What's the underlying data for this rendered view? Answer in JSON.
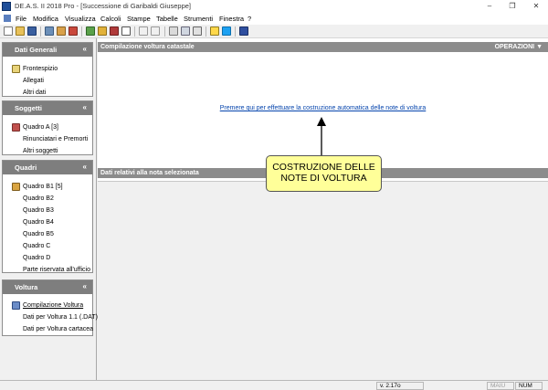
{
  "window": {
    "title": "DE.A.S. II 2018 Pro - [Successione di Garibaldi Giuseppe]",
    "controls": [
      "–",
      "❐",
      "✕"
    ]
  },
  "menubar": {
    "items": [
      "File",
      "Modifica",
      "Visualizza",
      "Calcoli",
      "Stampe",
      "Tabelle",
      "Strumenti",
      "Finestra",
      "?"
    ]
  },
  "sidebar": {
    "panels": [
      {
        "title": "Dati Generali",
        "items": [
          "Frontespizio",
          "Allegati",
          "Altri dati"
        ]
      },
      {
        "title": "Soggetti",
        "items": [
          "Quadro A [3]",
          "Rinunciatari e Premorti",
          "Altri soggetti"
        ]
      },
      {
        "title": "Quadri",
        "items": [
          "Quadro B1 [5]",
          "Quadro B2",
          "Quadro B3",
          "Quadro B4",
          "Quadro B5",
          "Quadro C",
          "Quadro D",
          "Parte riservata all'ufficio"
        ]
      },
      {
        "title": "Voltura",
        "items": [
          "Compilazione Voltura",
          "Dati per Voltura 1.1 (.DAT)",
          "Dati per Voltura cartacea"
        ]
      }
    ]
  },
  "main": {
    "section1_title": "Compilazione voltura catastale",
    "operations_label": "OPERAZIONI ▼",
    "link_text": "Premere qui per effettuare la costruzione automatica delle note di voltura",
    "section2_title": "Dati relativi alla nota selezionata"
  },
  "callout": {
    "line1": "COSTRUZIONE DELLE",
    "line2": "NOTE DI VOLTURA"
  },
  "statusbar": {
    "version": "v. 2.17o",
    "caps": "MAIU",
    "num": "NUM"
  }
}
